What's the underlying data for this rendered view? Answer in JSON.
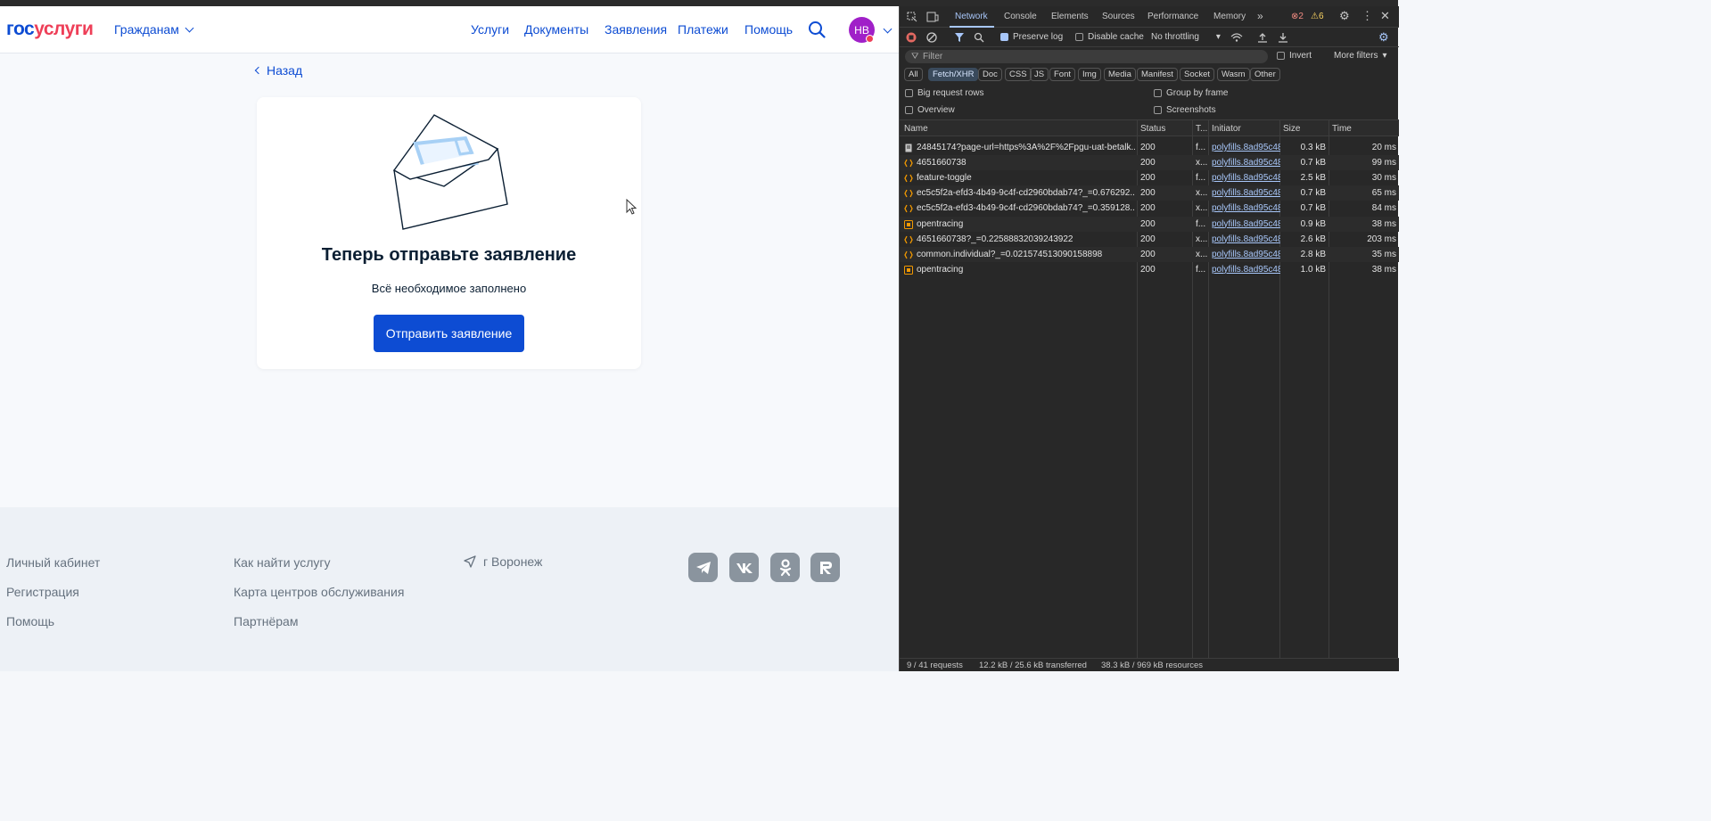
{
  "header": {
    "logo_part1": "гос",
    "logo_part2": "услуги",
    "audience": "Гражданам",
    "nav": [
      "Услуги",
      "Документы",
      "Заявления",
      "Платежи",
      "Помощь"
    ],
    "avatar_initials": "НВ"
  },
  "back_label": "Назад",
  "card": {
    "title": "Теперь отправьте заявление",
    "subtitle": "Всё необходимое заполнено",
    "submit_label": "Отправить заявление"
  },
  "footer": {
    "col1": [
      "Личный кабинет",
      "Регистрация",
      "Помощь"
    ],
    "col2": [
      "Как найти услугу",
      "Карта центров обслуживания",
      "Партнёрам"
    ],
    "city": "г Воронеж",
    "socials": [
      "telegram-icon",
      "vk-icon",
      "ok-icon",
      "rutube-icon"
    ]
  },
  "devtools": {
    "tabs": [
      "Network",
      "Console",
      "Elements",
      "Sources",
      "Performance",
      "Memory"
    ],
    "errors": "2",
    "warnings": "6",
    "preserve_log": "Preserve log",
    "disable_cache": "Disable cache",
    "throttling": "No throttling",
    "filter_placeholder": "Filter",
    "invert": "Invert",
    "more_filters": "More filters",
    "types": [
      "All",
      "Fetch/XHR",
      "Doc",
      "CSS",
      "JS",
      "Font",
      "Img",
      "Media",
      "Manifest",
      "Socket",
      "Wasm",
      "Other"
    ],
    "selected_type": "Fetch/XHR",
    "options": [
      "Big request rows",
      "Group by frame",
      "Overview",
      "Screenshots"
    ],
    "columns": [
      "Name",
      "Status",
      "T...",
      "Initiator",
      "Size",
      "Time"
    ],
    "requests": [
      {
        "name": "24845174?page-url=https%3A%2F%2Fpgu-uat-betalk...",
        "status": "200",
        "type": "f...",
        "initiator": "polyfills.8ad95c48",
        "size": "0.3 kB",
        "time": "20 ms",
        "kind": "doc"
      },
      {
        "name": "4651660738",
        "status": "200",
        "type": "x...",
        "initiator": "polyfills.8ad95c48",
        "size": "0.7 kB",
        "time": "99 ms",
        "kind": "xhr"
      },
      {
        "name": "feature-toggle",
        "status": "200",
        "type": "f...",
        "initiator": "polyfills.8ad95c48",
        "size": "2.5 kB",
        "time": "30 ms",
        "kind": "xhr"
      },
      {
        "name": "ec5c5f2a-efd3-4b49-9c4f-cd2960bdab74?_=0.676292...",
        "status": "200",
        "type": "x...",
        "initiator": "polyfills.8ad95c48",
        "size": "0.7 kB",
        "time": "65 ms",
        "kind": "xhr"
      },
      {
        "name": "ec5c5f2a-efd3-4b49-9c4f-cd2960bdab74?_=0.359128...",
        "status": "200",
        "type": "x...",
        "initiator": "polyfills.8ad95c48",
        "size": "0.7 kB",
        "time": "84 ms",
        "kind": "xhr"
      },
      {
        "name": "opentracing",
        "status": "200",
        "type": "f...",
        "initiator": "polyfills.8ad95c48",
        "size": "0.9 kB",
        "time": "38 ms",
        "kind": "fetch"
      },
      {
        "name": "4651660738?_=0.22588832039243922",
        "status": "200",
        "type": "x...",
        "initiator": "polyfills.8ad95c48",
        "size": "2.6 kB",
        "time": "203 ms",
        "kind": "xhr"
      },
      {
        "name": "common.individual?_=0.021574513090158898",
        "status": "200",
        "type": "x...",
        "initiator": "polyfills.8ad95c48",
        "size": "2.8 kB",
        "time": "35 ms",
        "kind": "xhr"
      },
      {
        "name": "opentracing",
        "status": "200",
        "type": "f...",
        "initiator": "polyfills.8ad95c48",
        "size": "1.0 kB",
        "time": "38 ms",
        "kind": "fetch"
      }
    ],
    "summary_requests": "9 / 41 requests",
    "summary_transferred": "12.2 kB / 25.6 kB transferred",
    "summary_resources": "38.3 kB / 969 kB resources"
  },
  "colors": {
    "brand_blue": "#0d4cd3",
    "brand_red": "#ee3f58",
    "devtools_bg": "#282828",
    "devtools_accent": "#a8c7fa"
  }
}
